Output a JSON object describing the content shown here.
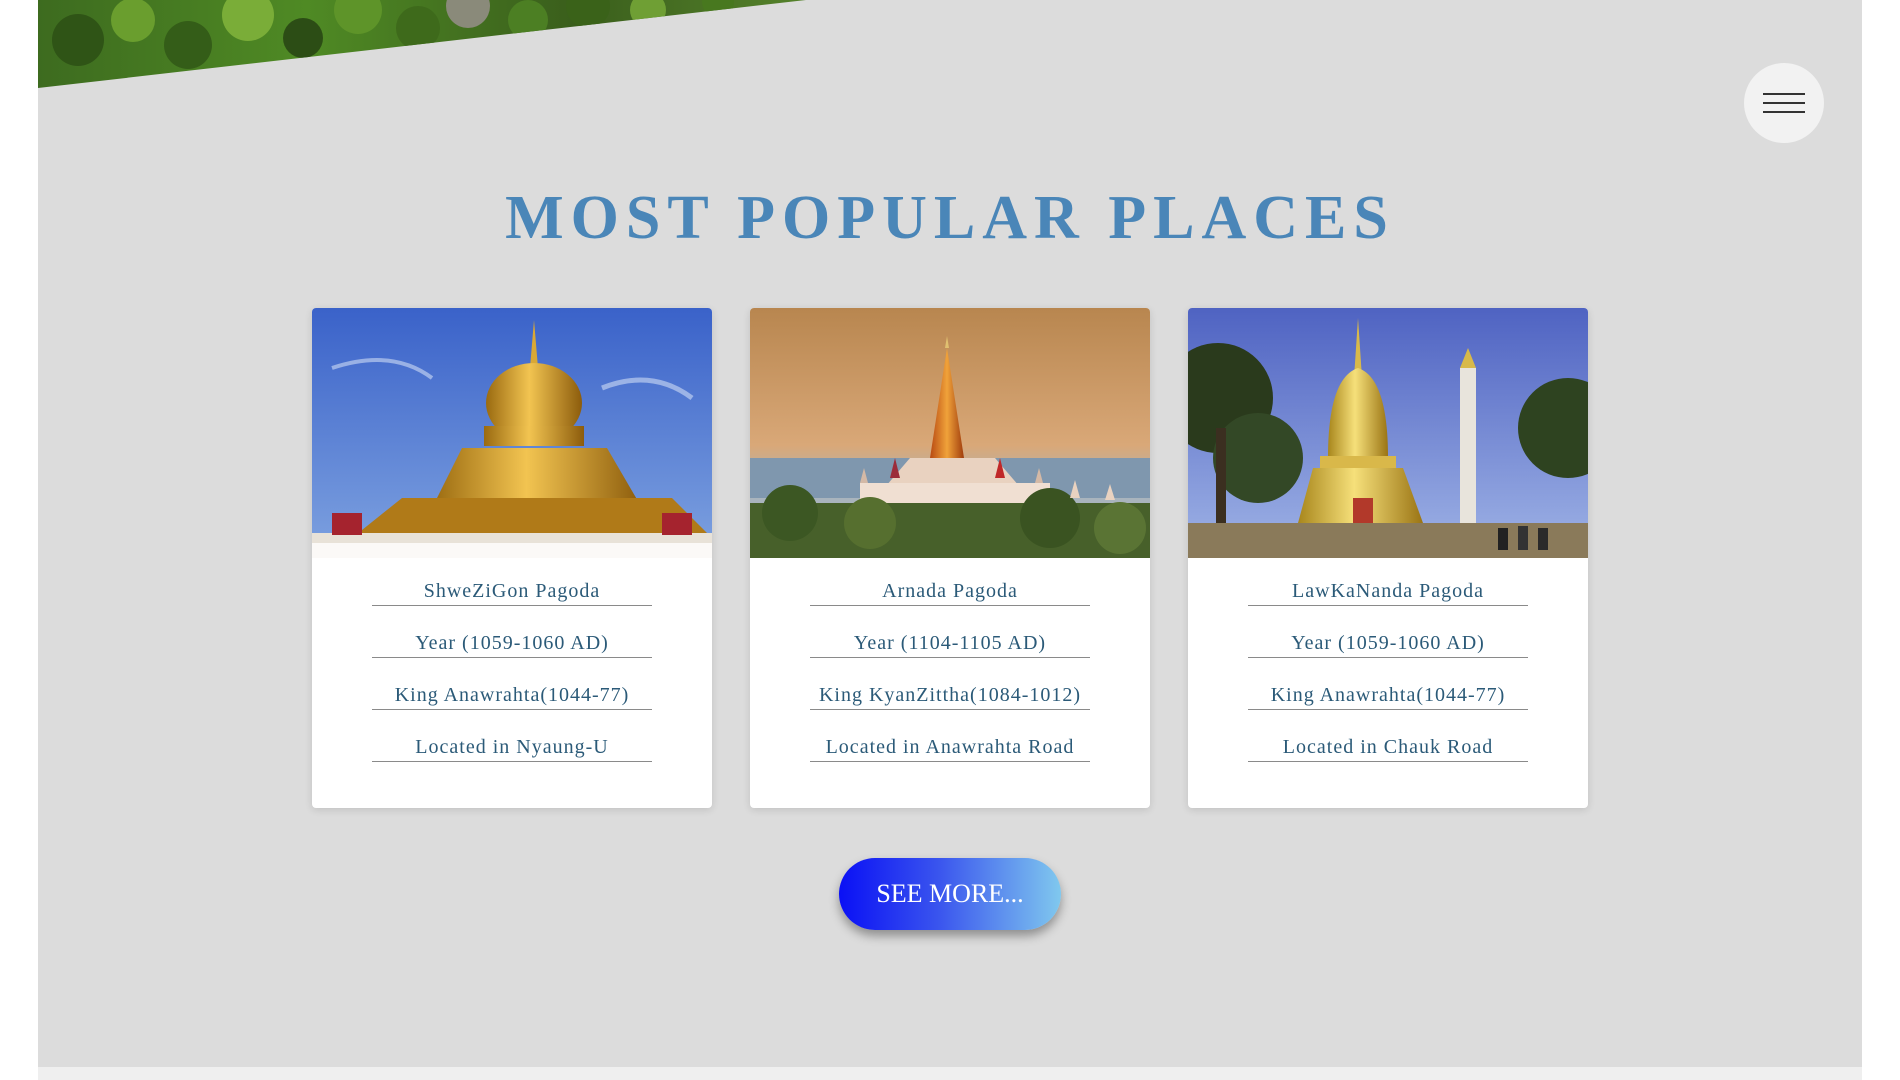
{
  "section": {
    "title": "MOST POPULAR PLACES"
  },
  "menu": {
    "icon": "hamburger-menu-icon"
  },
  "places": [
    {
      "image": "shwezigon-pagoda-photo",
      "name": "ShweZiGon Pagoda",
      "year": "Year (1059-1060 AD)",
      "king": "King Anawrahta(1044-77)",
      "location": "Located in Nyaung-U"
    },
    {
      "image": "ananda-temple-photo",
      "name": "Arnada Pagoda",
      "year": "Year (1104-1105 AD)",
      "king": "King KyanZittha(1084-1012)",
      "location": "Located in Anawrahta Road"
    },
    {
      "image": "lawkananda-pagoda-photo",
      "name": "LawKaNanda Pagoda",
      "year": "Year (1059-1060 AD)",
      "king": "King Anawrahta(1044-77)",
      "location": "Located in Chauk Road"
    }
  ],
  "see_more": {
    "label": "SEE MORE..."
  },
  "colors": {
    "title": "#4a86b8",
    "card_text": "#2b5a78",
    "background": "#dcdcdc",
    "button_start": "#0a10f5",
    "button_end": "#80c8ee"
  }
}
